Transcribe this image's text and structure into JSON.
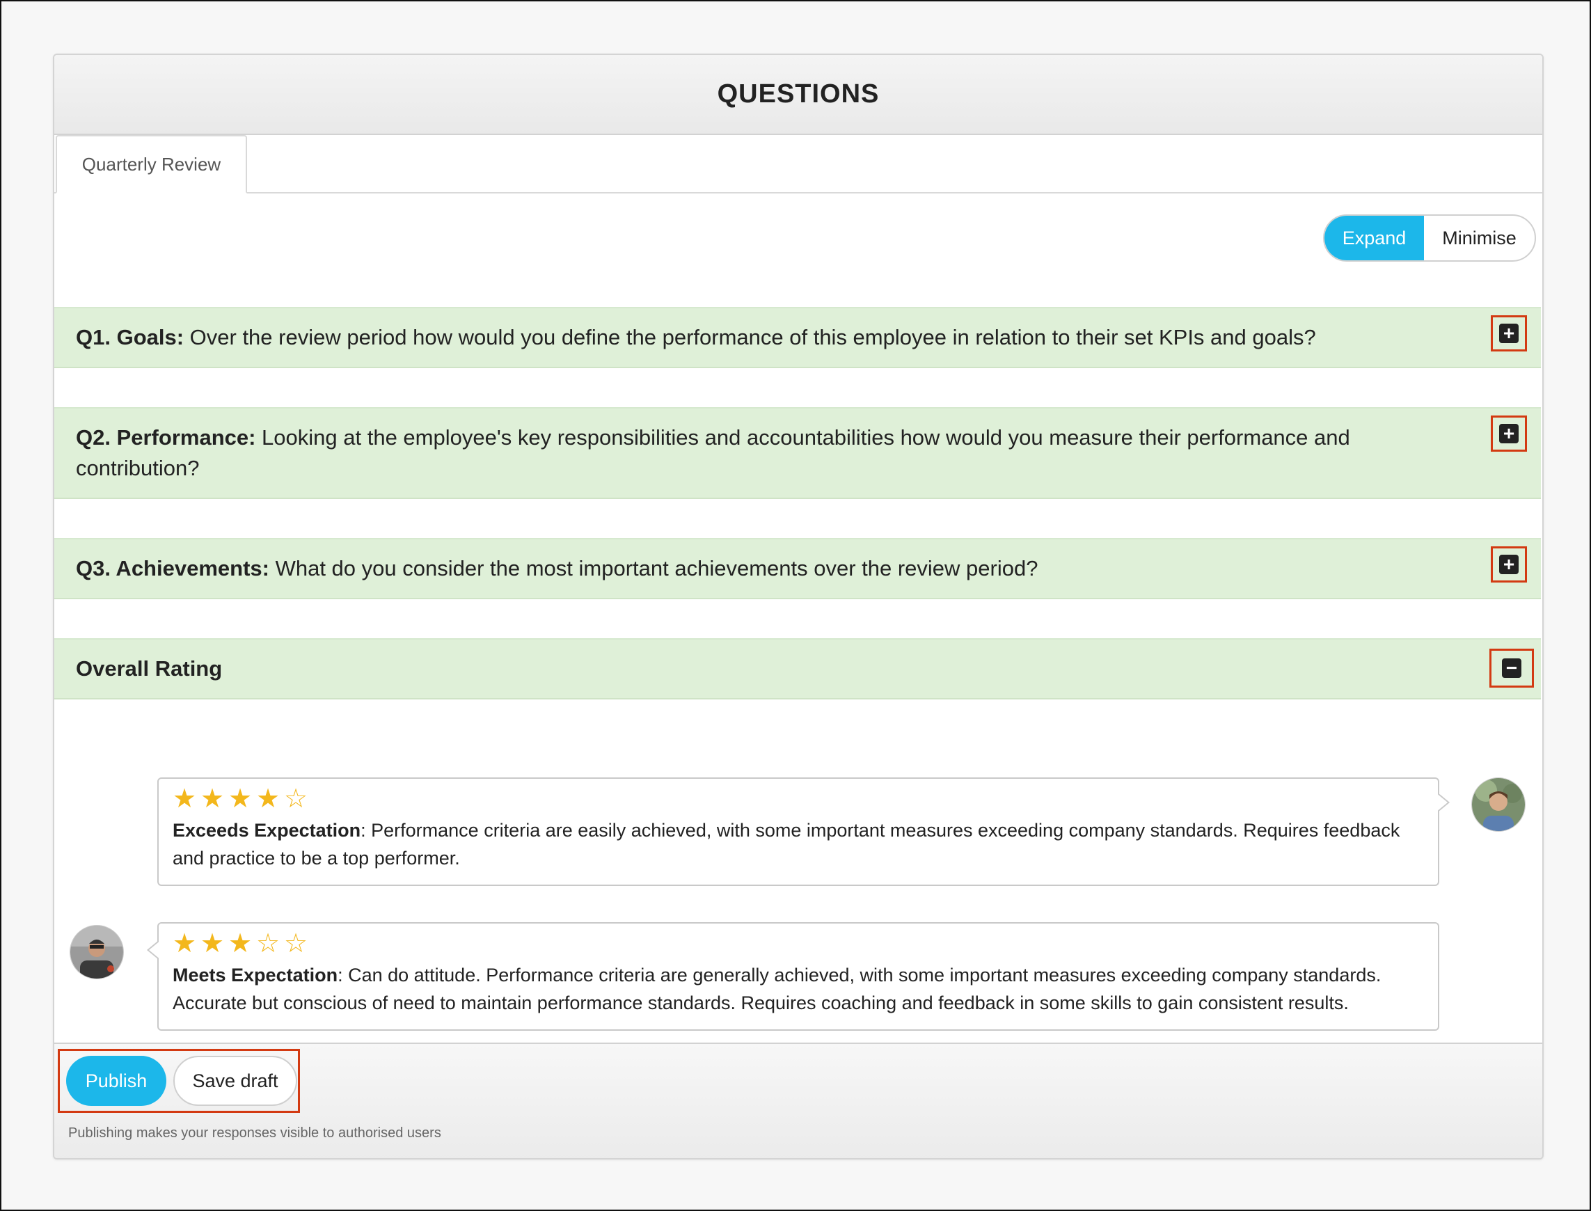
{
  "header": {
    "title": "QUESTIONS"
  },
  "tabs": [
    {
      "label": "Quarterly Review",
      "active": true
    }
  ],
  "view_toggle": {
    "expand_label": "Expand",
    "minimise_label": "Minimise",
    "active": "Expand"
  },
  "questions": [
    {
      "number": "Q1. Goals:",
      "text": " Over the review period how would you define the performance of this employee in relation to their set KPIs and goals?",
      "state": "collapsed",
      "icon": "plus-icon"
    },
    {
      "number": "Q2. Performance:",
      "text": " Looking at the employee's key responsibilities and accountabilities how would you measure their performance and contribution?",
      "state": "collapsed",
      "icon": "plus-icon"
    },
    {
      "number": "Q3. Achievements:",
      "text": " What do you consider the most important achievements over the review period?",
      "state": "collapsed",
      "icon": "plus-icon"
    }
  ],
  "overall_rating": {
    "title": "Overall Rating",
    "state": "expanded",
    "icon": "minus-icon",
    "responses": [
      {
        "stars": 4,
        "max_stars": 5,
        "label": "Exceeds Expectation",
        "text": ": Performance criteria are easily achieved, with some important measures exceeding company standards. Requires feedback and practice to be a top performer.",
        "avatar": "manager-avatar"
      },
      {
        "stars": 3,
        "max_stars": 5,
        "label": "Meets Expectation",
        "text": ": Can do attitude. Performance criteria are generally achieved, with some important measures exceeding company standards. Accurate but conscious of need to maintain performance standards. Requires coaching and feedback in some skills to gain consistent results.",
        "avatar": "employee-avatar"
      }
    ]
  },
  "footer": {
    "publish_label": "Publish",
    "save_draft_label": "Save draft",
    "note": "Publishing makes your responses visible to authorised users"
  },
  "colors": {
    "accent": "#1cb7ea",
    "question_row": "#dff0d8",
    "highlight_border": "#d33a12",
    "star": "#f3b71c"
  }
}
